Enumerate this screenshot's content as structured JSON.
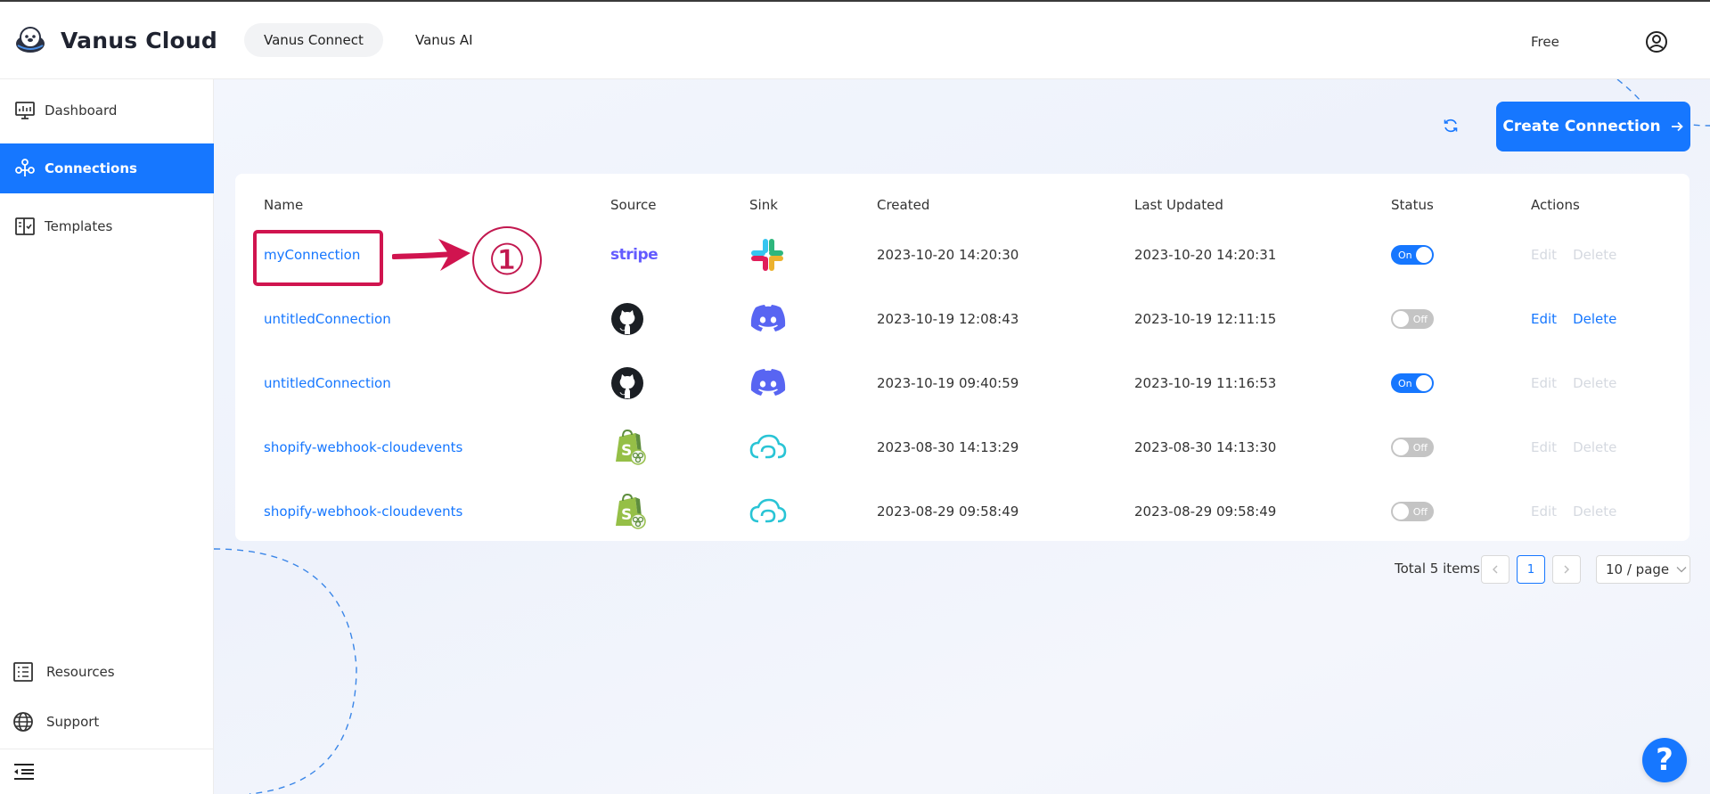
{
  "brand": {
    "name": "Vanus Cloud"
  },
  "top_nav": [
    {
      "label": "Vanus Connect",
      "active": true
    },
    {
      "label": "Vanus AI",
      "active": false
    }
  ],
  "plan_label": "Free",
  "sidebar": {
    "items": [
      {
        "label": "Dashboard",
        "icon": "monitor-icon"
      },
      {
        "label": "Connections",
        "icon": "connections-icon",
        "active": true
      },
      {
        "label": "Templates",
        "icon": "templates-icon"
      }
    ],
    "bottom_items": [
      {
        "label": "Resources",
        "icon": "resources-icon"
      },
      {
        "label": "Support",
        "icon": "globe-icon"
      }
    ]
  },
  "toolbar": {
    "create_label": "Create Connection"
  },
  "table": {
    "columns": [
      "Name",
      "Source",
      "Sink",
      "Created",
      "Last Updated",
      "Status",
      "Actions"
    ],
    "rows": [
      {
        "name": "myConnection",
        "source": "stripe",
        "sink": "slack",
        "created": "2023-10-20 14:20:30",
        "updated": "2023-10-20 14:20:31",
        "status": "On",
        "edit": "Edit",
        "delete": "Delete",
        "actions_enabled": false
      },
      {
        "name": "untitledConnection",
        "source": "github",
        "sink": "discord",
        "created": "2023-10-19 12:08:43",
        "updated": "2023-10-19 12:11:15",
        "status": "Off",
        "edit": "Edit",
        "delete": "Delete",
        "actions_enabled": true
      },
      {
        "name": "untitledConnection",
        "source": "github",
        "sink": "discord",
        "created": "2023-10-19 09:40:59",
        "updated": "2023-10-19 11:16:53",
        "status": "On",
        "edit": "Edit",
        "delete": "Delete",
        "actions_enabled": false
      },
      {
        "name": "shopify-webhook-cloudevents",
        "source": "shopify",
        "sink": "cloudevents",
        "created": "2023-08-30 14:13:29",
        "updated": "2023-08-30 14:13:30",
        "status": "Off",
        "edit": "Edit",
        "delete": "Delete",
        "actions_enabled": false
      },
      {
        "name": "shopify-webhook-cloudevents",
        "source": "shopify",
        "sink": "cloudevents",
        "created": "2023-08-29 09:58:49",
        "updated": "2023-08-29 09:58:49",
        "status": "Off",
        "edit": "Edit",
        "delete": "Delete",
        "actions_enabled": false
      }
    ]
  },
  "pagination": {
    "total": "Total 5 items",
    "current": "1",
    "page_size": "10 / page"
  },
  "annotation": {
    "number": "①"
  },
  "help": {
    "label": "?"
  },
  "colors": {
    "accent": "#1677ff",
    "annotation": "#d0144f",
    "stripe": "#635bff",
    "discord": "#5865f2"
  }
}
